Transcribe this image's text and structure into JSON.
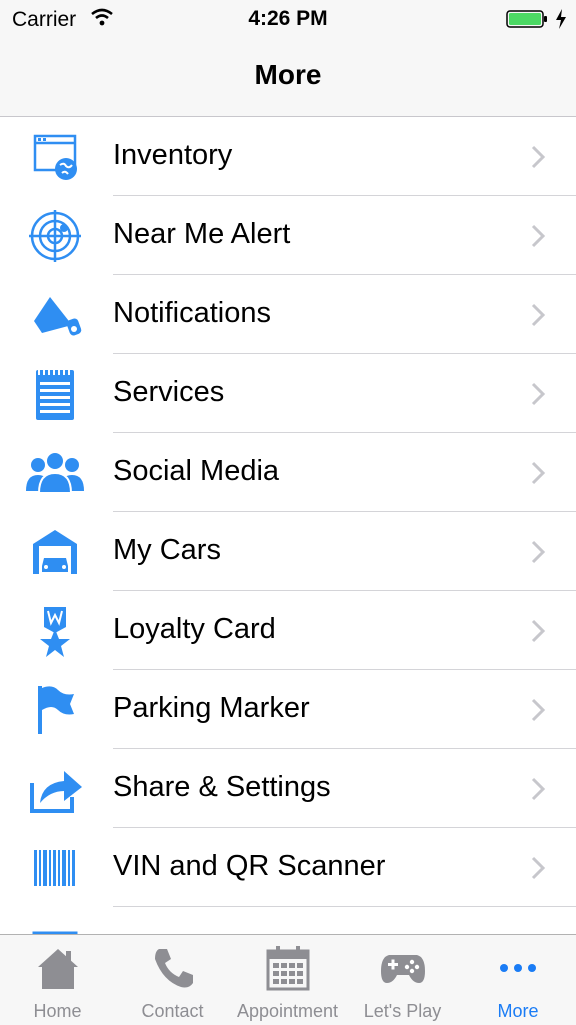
{
  "status_bar": {
    "carrier": "Carrier",
    "time": "4:26 PM",
    "battery_color": "#4cd964"
  },
  "nav": {
    "title": "More"
  },
  "colors": {
    "accent": "#2f8ef2",
    "tab_active": "#1a7cf5",
    "tab_inactive": "#8e8e93"
  },
  "menu": {
    "items": [
      {
        "label": "Inventory",
        "icon": "inventory-icon"
      },
      {
        "label": "Near Me Alert",
        "icon": "radar-icon"
      },
      {
        "label": "Notifications",
        "icon": "megaphone-icon"
      },
      {
        "label": "Services",
        "icon": "notepad-icon"
      },
      {
        "label": "Social Media",
        "icon": "people-icon"
      },
      {
        "label": "My Cars",
        "icon": "garage-icon"
      },
      {
        "label": "Loyalty Card",
        "icon": "badge-star-icon"
      },
      {
        "label": "Parking Marker",
        "icon": "flag-icon"
      },
      {
        "label": "Share & Settings",
        "icon": "share-icon"
      },
      {
        "label": "VIN and QR Scanner",
        "icon": "barcode-icon"
      }
    ]
  },
  "tabs": [
    {
      "label": "Home",
      "icon": "home-icon"
    },
    {
      "label": "Contact",
      "icon": "phone-icon"
    },
    {
      "label": "Appointment",
      "icon": "calendar-icon"
    },
    {
      "label": "Let's Play",
      "icon": "gamepad-icon"
    },
    {
      "label": "More",
      "icon": "more-icon",
      "active": true
    }
  ]
}
